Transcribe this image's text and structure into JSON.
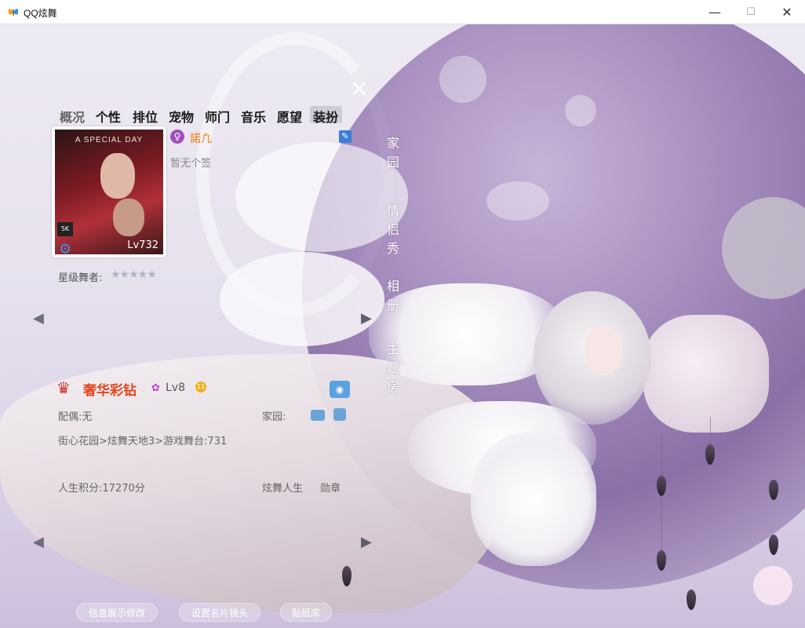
{
  "window": {
    "title": "QQ炫舞",
    "minimize": "—",
    "maximize": "☐",
    "close": "✕"
  },
  "tabs": [
    {
      "label": "概况"
    },
    {
      "label": "个性"
    },
    {
      "label": "排位"
    },
    {
      "label": "宠物"
    },
    {
      "label": "师门"
    },
    {
      "label": "音乐"
    },
    {
      "label": "愿望"
    },
    {
      "label": "装扮"
    }
  ],
  "profile": {
    "poster_title": "A SPECIAL DAY",
    "poster_badge": "5K",
    "level": "Lv732",
    "gender_icon": "♀",
    "nickname": "諾凢",
    "signature": "暂无个签",
    "star_label": "星级舞者:",
    "stars": "★★★★★"
  },
  "vertical_nav": [
    {
      "label": "家园"
    },
    {
      "label": "情侣秀"
    },
    {
      "label": "相册"
    },
    {
      "label": "主题房"
    }
  ],
  "vip": {
    "title": "奢华彩钻",
    "level": "Lv8",
    "coin": "11"
  },
  "info": {
    "spouse": "配偶:无",
    "location_label": "家园:",
    "location": "街心花园>炫舞天地3>游戏舞台:731",
    "life_score": "人生积分:17270分",
    "life_label": "炫舞人生",
    "medal": "勋章"
  },
  "bottom_buttons": [
    {
      "label": "信息展示修改"
    },
    {
      "label": "设置名片镜头"
    },
    {
      "label": "贴纸库"
    }
  ]
}
